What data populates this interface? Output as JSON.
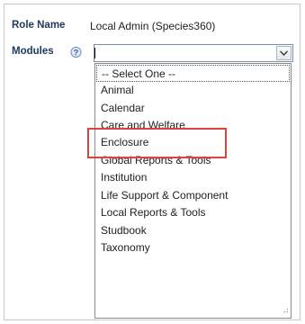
{
  "form": {
    "role_label": "Role Name",
    "role_value": "Local Admin (Species360)",
    "modules_label": "Modules",
    "modules_value": ""
  },
  "icons": {
    "help": "help-question-icon",
    "dropdown": "chevron-down-icon",
    "grip": "resize-grip-icon"
  },
  "dropdown": {
    "options": [
      "-- Select One --",
      "Animal",
      "Calendar",
      "Care and Welfare",
      "Enclosure",
      "Global Reports & Tools",
      "Institution",
      "Life Support & Component",
      "Local Reports & Tools",
      "Studbook",
      "Taxonomy"
    ],
    "highlighted": "Care and Welfare"
  },
  "colors": {
    "label": "#1f3a60",
    "highlight_border": "#d9443d",
    "select_border": "#7a8ea6"
  }
}
